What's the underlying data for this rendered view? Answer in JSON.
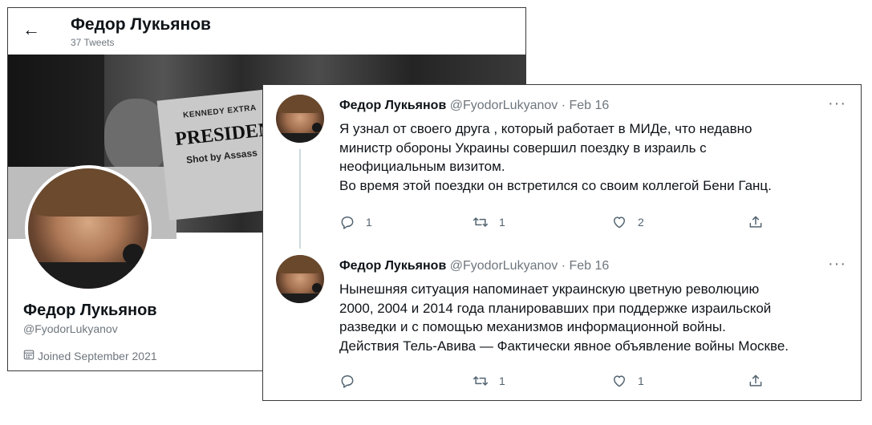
{
  "profile": {
    "header_name": "Федор Лукьянов",
    "tweet_count": "37 Tweets",
    "banner_text": [
      "KENNEDY EXTRA",
      "PRESIDENT DE",
      "Shot by Assass"
    ],
    "name": "Федор Лукьянов",
    "handle": "@FyodorLukyanov",
    "joined": "Joined September 2021",
    "icons": {
      "back": "back-arrow-icon",
      "calendar": "calendar-icon"
    }
  },
  "tweets": [
    {
      "name": "Федор Лукьянов",
      "meta": "@FyodorLukyanov · Feb 16",
      "lines": [
        "Я узнал от своего друга , который работает в МИДе, что недавно",
        "министр обороны Украины совершил поездку в израиль с",
        "неофициальным визитом.",
        "Во время этой поездки он встретился со своим коллегой Бени Ганц."
      ],
      "reply_count": "1",
      "retweet_count": "1",
      "like_count": "2",
      "share_count": ""
    },
    {
      "name": "Федор Лукьянов",
      "meta": "@FyodorLukyanov · Feb 16",
      "lines": [
        "Нынешняя ситуация напоминает украинскую цветную революцию",
        "2000, 2004 и 2014 года планировавших при поддержке израильской",
        "разведки и с помощью механизмов информационной войны.",
        "Действия Тель-Авива — Фактически явное объявление войны Москве."
      ],
      "reply_count": "",
      "retweet_count": "1",
      "like_count": "1",
      "share_count": ""
    }
  ],
  "more_label": "···",
  "colors": {
    "text": "#0f1419",
    "muted": "#6e767d",
    "icon": "#536471",
    "thread": "#cfd9de"
  }
}
